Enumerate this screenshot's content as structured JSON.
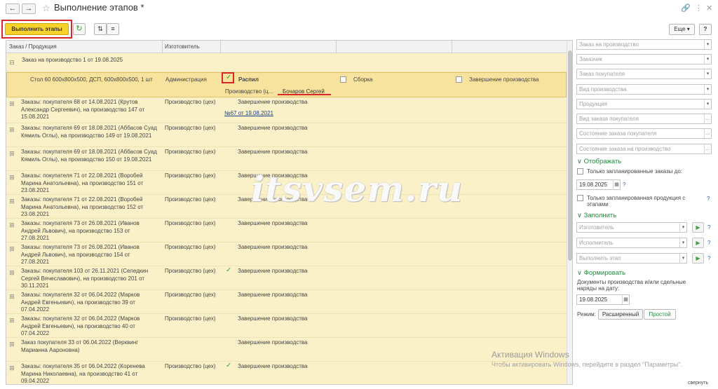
{
  "window": {
    "title": "Выполнение этапов *"
  },
  "toolbar": {
    "execute_label": "Выполнить этапы",
    "more_label": "Еще",
    "help_label": "?"
  },
  "table": {
    "headers": [
      "Заказ / Продукция",
      "Изготовитель"
    ],
    "group_label": "Заказ на производство 1 от 19.08.2025",
    "selected_row": {
      "product": "Стол 60 600х800х500, ДСП, 600х800х500, 1 шт",
      "maker": "Администрация",
      "stages": [
        "Распил",
        "Сборка",
        "Завершение производства"
      ],
      "stage_unit": "Производство (ц...",
      "executor": "Бочаров Сергей"
    },
    "rows": [
      {
        "order": "Заказы: покупателя 68 от 14.08.2021 (Крутов Александр Сергеевич), на производство 147 от 15.08.2021",
        "maker": "Производство (цех)",
        "stage": "Завершение производства",
        "link": "№67 от 19.08.2021",
        "check": false
      },
      {
        "order": "Заказы: покупателя 69 от 18.08.2021 (Аббасов Суад Кямиль Оглы), на производство 149 от 19.08.2021",
        "maker": "Производство (цех)",
        "stage": "Завершение производства",
        "check": false
      },
      {
        "order": "Заказы: покупателя 69 от 18.08.2021 (Аббасов Суад Кямиль Оглы), на производство 150 от 19.08.2021",
        "maker": "Производство (цех)",
        "stage": "Завершение производства",
        "check": false
      },
      {
        "order": "Заказы: покупателя 71 от 22.08.2021 (Воробей Марина Анатольевна), на производство 151 от 23.08.2021",
        "maker": "Производство (цех)",
        "stage": "Завершение производства",
        "check": false
      },
      {
        "order": "Заказы: покупателя 71 от 22.08.2021 (Воробей Марина Анатольевна), на производство 152 от 23.08.2021",
        "maker": "Производство (цех)",
        "stage": "Завершение производства",
        "check": false
      },
      {
        "order": "Заказы: покупателя 73 от 26.08.2021 (Иванов Андрей Львович), на производство 153 от 27.08.2021",
        "maker": "Производство (цех)",
        "stage": "Завершение производства",
        "check": false
      },
      {
        "order": "Заказы: покупателя 73 от 26.08.2021 (Иванов Андрей Львович), на производство 154 от 27.08.2021",
        "maker": "Производство (цех)",
        "stage": "Завершение производства",
        "check": false
      },
      {
        "order": "Заказы: покупателя 103 от 26.11.2021 (Селедкин Сергей Вячеславович), на производство 201 от 30.11.2021",
        "maker": "Производство (цех)",
        "stage": "Завершение производства",
        "check": true
      },
      {
        "order": "Заказы: покупателя 32 от 06.04.2022 (Марков Андрей Евгеньевич), на производство 39 от 07.04.2022",
        "maker": "Производство (цех)",
        "stage": "Завершение производства",
        "check": false
      },
      {
        "order": "Заказы: покупателя 32 от 06.04.2022 (Марков Андрей Евгеньевич), на производство 40 от 07.04.2022",
        "maker": "Производство (цех)",
        "stage": "Завершение производства",
        "check": false
      },
      {
        "order": "Заказ покупателя 33 от 06.04.2022 (Верквинг Марианна Аароновна)",
        "maker": "",
        "stage": "Завершение производства",
        "check": false
      },
      {
        "order": "Заказы: покупателя 35 от 06.04.2022 (Коренева Марина Николаевна), на производство 41 от 09.04.2022",
        "maker": "Производство (цех)",
        "stage": "Завершение производства",
        "check": true
      }
    ]
  },
  "filters": {
    "fields": [
      "Заказ на производство",
      "Заказчик",
      "Заказ покупателя",
      "Вид производства",
      "Продукция",
      "Вид заказа покупателя",
      "Состояние заказа покупателя",
      "Состояние заказа на производство"
    ],
    "display_title": "Отображать",
    "only_planned_orders": "Только запланированные заказы до:",
    "planned_date": "19.08.2025",
    "only_planned_products": "Только запланированная продукция с этапами",
    "fill_title": "Заполнить",
    "fill_fields": [
      "Изготовитель",
      "Исполнитель",
      "Выполнить этап"
    ],
    "form_title": "Формировать",
    "form_text": "Документы производства и/или сдельные наряды на дату:",
    "form_date": "19.08.2025",
    "mode_label": "Режим:",
    "mode_extended": "Расширенный",
    "mode_simple": "Простой",
    "help": "?"
  },
  "overlay": {
    "watermark": "itsvsem.ru",
    "win_activation": "Активация Windows",
    "win_activation_hint": "Чтобы активировать Windows, перейдите в раздел \"Параметры\".",
    "corner_text": "свернуть"
  },
  "colors": {
    "accent": "#f7d22b",
    "highlight": "#d9262a",
    "row_bg": "#fbf1c9",
    "section": "#1f8b3c"
  }
}
